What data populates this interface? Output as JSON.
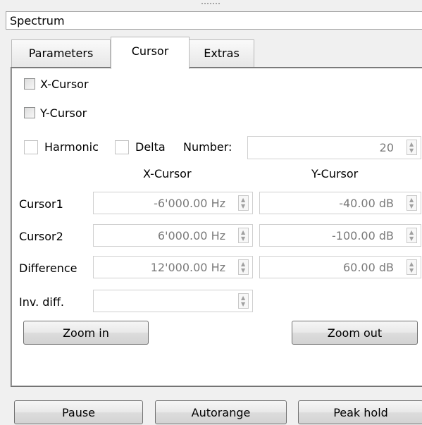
{
  "window": {
    "title": "Spectrum"
  },
  "tabs": [
    {
      "label": "Parameters",
      "active": false
    },
    {
      "label": "Cursor",
      "active": true
    },
    {
      "label": "Extras",
      "active": false
    }
  ],
  "cursor_panel": {
    "x_cursor_checkbox": {
      "label": "X-Cursor",
      "checked": false
    },
    "y_cursor_checkbox": {
      "label": "Y-Cursor",
      "checked": false
    },
    "harmonic_checkbox": {
      "label": "Harmonic",
      "checked": false
    },
    "delta_checkbox": {
      "label": "Delta",
      "checked": false
    },
    "number": {
      "label": "Number:",
      "value": "20"
    },
    "column_headers": {
      "x": "X-Cursor",
      "y": "Y-Cursor"
    },
    "rows": [
      {
        "label": "Cursor1",
        "x_value": "-6'000.00 Hz",
        "y_value": "-40.00 dB"
      },
      {
        "label": "Cursor2",
        "x_value": "6'000.00 Hz",
        "y_value": "-100.00 dB"
      },
      {
        "label": "Difference",
        "x_value": "12'000.00 Hz",
        "y_value": "60.00 dB"
      },
      {
        "label": "Inv. diff.",
        "x_value": ""
      }
    ],
    "zoom_in_label": "Zoom in",
    "zoom_out_label": "Zoom out"
  },
  "bottom_buttons": {
    "pause": "Pause",
    "autorange": "Autorange",
    "peak_hold": "Peak hold"
  }
}
